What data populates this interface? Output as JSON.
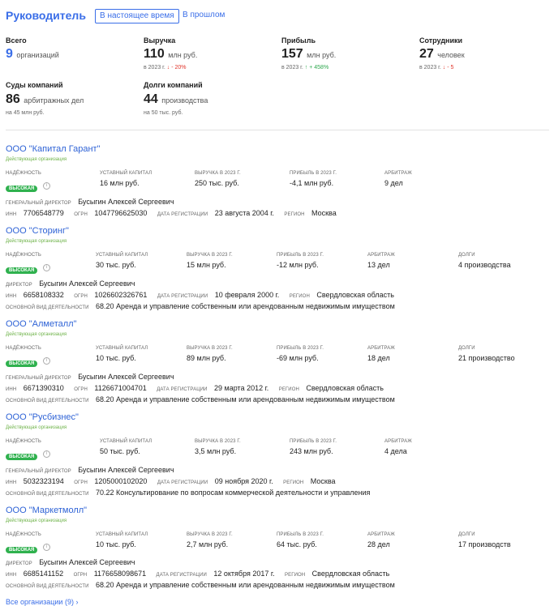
{
  "header": {
    "title": "Руководитель",
    "tab_now": "В настоящее время",
    "tab_past": "В прошлом"
  },
  "stats": {
    "total": {
      "label": "Всего",
      "value": "9",
      "unit": "организаций"
    },
    "revenue": {
      "label": "Выручка",
      "value": "110",
      "unit": "млн руб.",
      "sub_prefix": "в 2023 г.",
      "sub_change": "↓ - 20%"
    },
    "profit": {
      "label": "Прибыль",
      "value": "157",
      "unit": "млн руб.",
      "sub_prefix": "в 2023 г.",
      "sub_change": "↑ + 458%"
    },
    "employees": {
      "label": "Сотрудники",
      "value": "27",
      "unit": "человек",
      "sub_prefix": "в 2023 г.",
      "sub_change": "↓ - 5"
    },
    "courts": {
      "label": "Суды компаний",
      "value": "86",
      "unit": "арбитражных дел",
      "sub": "на 45 млн руб."
    },
    "debts": {
      "label": "Долги компаний",
      "value": "44",
      "unit": "производства",
      "sub": "на 50 тыс. руб."
    }
  },
  "labels": {
    "reliability": "Надёжность",
    "capital": "Уставный капитал",
    "revenue": "Выручка в 2023 г.",
    "profit": "Прибыль в 2023 г.",
    "arbitration": "Арбитраж",
    "debts": "Долги",
    "inn": "ИНН",
    "ogrn": "ОГРН",
    "reg_date": "Дата регистрации",
    "region": "Регион",
    "activity": "Основной вид деятельности",
    "badge": "ВЫСОКАЯ",
    "info": "i"
  },
  "companies": [
    {
      "name": "ООО \"Капитал Гарант\"",
      "status": "Действующая организация",
      "capital": "16 млн руб.",
      "revenue": "250 тыс. руб.",
      "profit": "-4,1 млн руб.",
      "arbitration": "9 дел",
      "debts": "",
      "director_label": "Генеральный директор",
      "director": "Бусыгин Алексей Сергеевич",
      "inn": "7706548779",
      "ogrn": "1047796625030",
      "reg_date": "23 августа 2004 г.",
      "region": "Москва",
      "activity": ""
    },
    {
      "name": "ООО \"Сторинг\"",
      "status": "Действующая организация",
      "capital": "30 тыс. руб.",
      "revenue": "15 млн руб.",
      "profit": "-12 млн руб.",
      "arbitration": "13 дел",
      "debts": "4 производства",
      "director_label": "Директор",
      "director": "Бусыгин Алексей Сергеевич",
      "inn": "6658108332",
      "ogrn": "1026602326761",
      "reg_date": "10 февраля 2000 г.",
      "region": "Свердловская область",
      "activity": "68.20 Аренда и управление собственным или арендованным недвижимым имуществом"
    },
    {
      "name": "ООО \"Алметалл\"",
      "status": "Действующая организация",
      "capital": "10 тыс. руб.",
      "revenue": "89 млн руб.",
      "profit": "-69 млн руб.",
      "arbitration": "18 дел",
      "debts": "21 производство",
      "director_label": "Генеральный директор",
      "director": "Бусыгин Алексей Сергеевич",
      "inn": "6671390310",
      "ogrn": "1126671004701",
      "reg_date": "29 марта 2012 г.",
      "region": "Свердловская область",
      "activity": "68.20 Аренда и управление собственным или арендованным недвижимым имуществом"
    },
    {
      "name": "ООО \"Русбизнес\"",
      "status": "Действующая организация",
      "capital": "50 тыс. руб.",
      "revenue": "3,5 млн руб.",
      "profit": "243 млн руб.",
      "arbitration": "4 дела",
      "debts": "",
      "director_label": "Генеральный директор",
      "director": "Бусыгин Алексей Сергеевич",
      "inn": "5032323194",
      "ogrn": "1205000102020",
      "reg_date": "09 ноября 2020 г.",
      "region": "Москва",
      "activity": "70.22 Консультирование по вопросам коммерческой деятельности и управления"
    },
    {
      "name": "ООО \"Маркетмолл\"",
      "status": "Действующая организация",
      "capital": "10 тыс. руб.",
      "revenue": "2,7 млн руб.",
      "profit": "64 тыс. руб.",
      "arbitration": "28 дел",
      "debts": "17 производств",
      "director_label": "Директор",
      "director": "Бусыгин Алексей Сергеевич",
      "inn": "6685141152",
      "ogrn": "1176658098671",
      "reg_date": "12 октября 2017 г.",
      "region": "Свердловская область",
      "activity": "68.20 Аренда и управление собственным или арендованным недвижимым имуществом"
    }
  ],
  "footer": {
    "all_orgs": "Все организации (9)  ›"
  }
}
